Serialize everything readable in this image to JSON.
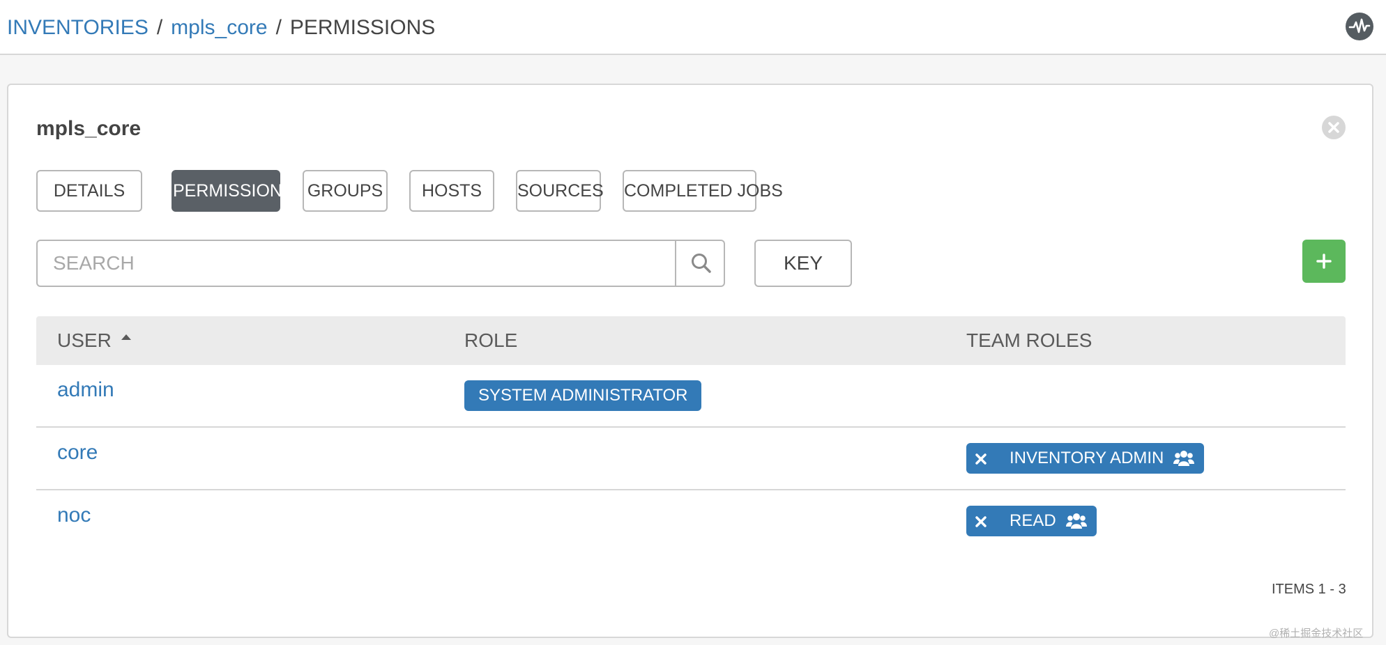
{
  "breadcrumb": {
    "items": [
      "INVENTORIES",
      "mpls_core"
    ],
    "separator": "/",
    "current": "PERMISSIONS"
  },
  "header": {
    "activity_icon": "activity-stream-icon"
  },
  "panel": {
    "title": "mpls_core",
    "tabs": [
      {
        "label": "DETAILS",
        "active": false
      },
      {
        "label": "PERMISSIONS",
        "active": true
      },
      {
        "label": "GROUPS",
        "active": false
      },
      {
        "label": "HOSTS",
        "active": false
      },
      {
        "label": "SOURCES",
        "active": false
      },
      {
        "label": "COMPLETED JOBS",
        "active": false
      }
    ],
    "search": {
      "placeholder": "SEARCH",
      "value": ""
    },
    "key_label": "KEY",
    "add_label": "+",
    "add_color": "#5cb85c",
    "table": {
      "columns": [
        "USER",
        "ROLE",
        "TEAM ROLES"
      ],
      "sort_column": "USER",
      "sort_direction": "ascending",
      "rows": [
        {
          "user": "admin",
          "role": "SYSTEM ADMINISTRATOR",
          "team_role": ""
        },
        {
          "user": "core",
          "role": "",
          "team_role": "INVENTORY ADMIN"
        },
        {
          "user": "noc",
          "role": "",
          "team_role": "READ"
        }
      ]
    },
    "items_label": "ITEMS  1 - 3"
  },
  "colors": {
    "link": "#337ab7",
    "badge": "#337ab7",
    "active_tab": "#5a6066",
    "add_button": "#5cb85c"
  },
  "watermark": "@稀土掘金技术社区"
}
